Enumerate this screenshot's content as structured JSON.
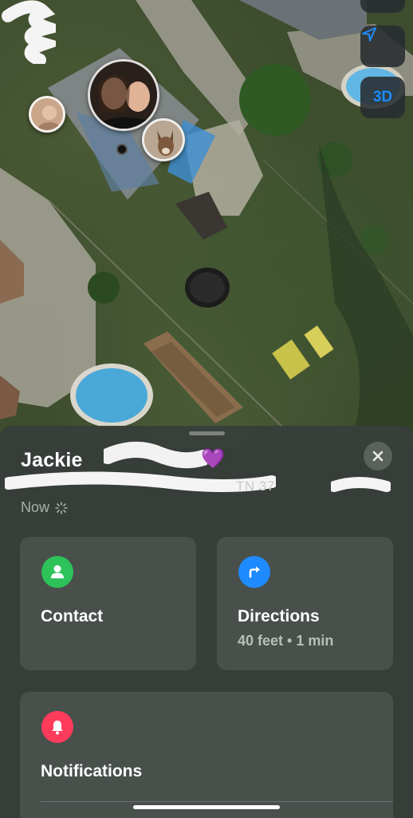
{
  "map": {
    "controls": {
      "compass_icon": "compass-icon",
      "locate_icon": "location-arrow-icon",
      "view_3d_label": "3D"
    },
    "colors": {
      "accent": "#1e8bff",
      "pool": "#4aa8d8",
      "grass": "#3e4d2e"
    }
  },
  "card": {
    "title": "Jackie",
    "title_emoji": "💜",
    "address": "TN 37",
    "status": "Now",
    "close_icon": "close-icon",
    "actions": [
      {
        "label": "Contact",
        "icon": "person-icon",
        "color": "#2ec25a"
      },
      {
        "label": "Directions",
        "subtitle": "40 feet • 1 min",
        "icon": "turn-right-arrow-icon",
        "color": "#1e8bff"
      }
    ],
    "notifications": {
      "label": "Notifications",
      "icon": "bell-icon",
      "color": "#ff3b5c"
    }
  }
}
